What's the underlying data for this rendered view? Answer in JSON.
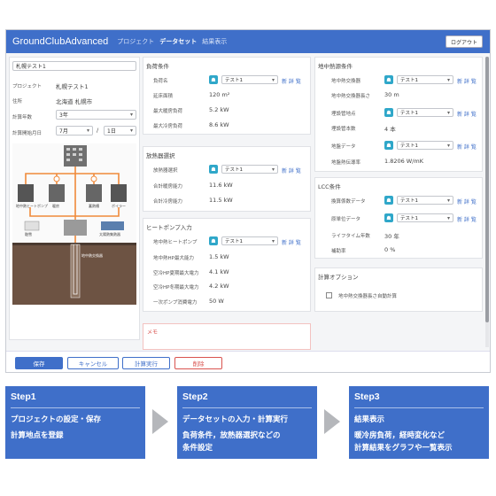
{
  "app": {
    "brand": "GroundClubAdvanced",
    "nav": [
      "プロジェクト",
      "データセット",
      "結果表示"
    ],
    "logout": "ログアウト"
  },
  "left": {
    "name_value": "札幌テスト1",
    "project_label": "プロジェクト",
    "project_value": "札幌テスト1",
    "address_label": "住所",
    "address_value": "北海道 札幌市",
    "years_label": "計算年数",
    "years_value": "3年",
    "start_label": "計算開始月日",
    "month_value": "7月",
    "slash": "/",
    "day_value": "1日",
    "diagram": {
      "floor": "暖房",
      "geo_heat_pump": "地中熱ヒートポンプ",
      "chiller": "ボイラー",
      "well": "地中熱交換器",
      "snow": "融雪",
      "solar": "太陽熱集熱器",
      "tank": "蓄熱槽",
      "road": "舗装"
    }
  },
  "load": {
    "title": "負荷条件",
    "rows": [
      {
        "label": "負荷名",
        "dd": "テスト1",
        "links": "新 詳 覧"
      },
      {
        "label": "延床面積",
        "value": "120 m²"
      },
      {
        "label": "最大暖房負荷",
        "value": "5.2 kW"
      },
      {
        "label": "最大冷房負荷",
        "value": "8.6 kW"
      }
    ]
  },
  "radiator": {
    "title": "放熱器選択",
    "rows": [
      {
        "label": "放熱器選択",
        "dd": "テスト1",
        "links": "新 詳 覧"
      },
      {
        "label": "合計暖房能力",
        "value": "11.6 kW"
      },
      {
        "label": "合計冷房能力",
        "value": "11.5 kW"
      }
    ]
  },
  "heatpump": {
    "title": "ヒートポンプ入力",
    "rows": [
      {
        "label": "地中熱ヒートポンプ",
        "dd": "テスト1",
        "links": "新 詳 覧"
      },
      {
        "label": "地中熱HP最大能力",
        "value": "1.5 kW"
      },
      {
        "label": "空冷HP夏期最大電力",
        "value": "4.1 kW"
      },
      {
        "label": "空冷HP冬期最大電力",
        "value": "4.2 kW"
      },
      {
        "label": "一次ポンプ消費電力",
        "value": "50 W"
      }
    ]
  },
  "memo": {
    "label": "メモ"
  },
  "ground": {
    "title": "地中熱源条件",
    "rows": [
      {
        "label": "地中熱交換器",
        "dd": "テスト1",
        "links": "新 詳 覧"
      },
      {
        "label": "地中熱交換器長さ",
        "value": "30 m"
      },
      {
        "label": "埋設管地点",
        "dd": "テスト1",
        "links": "新 詳 覧"
      },
      {
        "label": "埋設管本数",
        "value": "4 本"
      },
      {
        "label": "地盤データ",
        "dd": "テスト1",
        "links": "新 詳 覧"
      },
      {
        "label": "地盤熱伝導率",
        "value": "1.8206 W/mK"
      }
    ]
  },
  "lcc": {
    "title": "LCC条件",
    "rows": [
      {
        "label": "換算係数データ",
        "dd": "テスト1",
        "links": "新 詳 覧"
      },
      {
        "label": "原単位データ",
        "dd": "テスト1",
        "links": "新 詳 覧"
      },
      {
        "label": "ライフタイム年数",
        "value": "30 年"
      },
      {
        "label": "補助率",
        "value": "0 %"
      }
    ]
  },
  "options": {
    "title": "計算オプション",
    "check_label": "地中熱交換器長さ自動計算"
  },
  "buttons": {
    "save": "保存",
    "cancel": "キャンセル",
    "run": "計算実行",
    "delete": "削除"
  },
  "steps": [
    {
      "title": "Step1",
      "l1": "プロジェクトの設定・保存",
      "l2": "計算地点を登録",
      "l3": ""
    },
    {
      "title": "Step2",
      "l1": "データセットの入力・計算実行",
      "l2": "負荷条件，放熱器選択などの",
      "l3": "条件設定"
    },
    {
      "title": "Step3",
      "l1": "結果表示",
      "l2": "暖冷房負荷，経時変化など",
      "l3": "計算結果をグラフや一覧表示"
    }
  ],
  "colors": {
    "primary": "#3f6fc9",
    "accent": "#2fa7c9",
    "danger": "#d9534f",
    "orange": "#f08a3a"
  }
}
